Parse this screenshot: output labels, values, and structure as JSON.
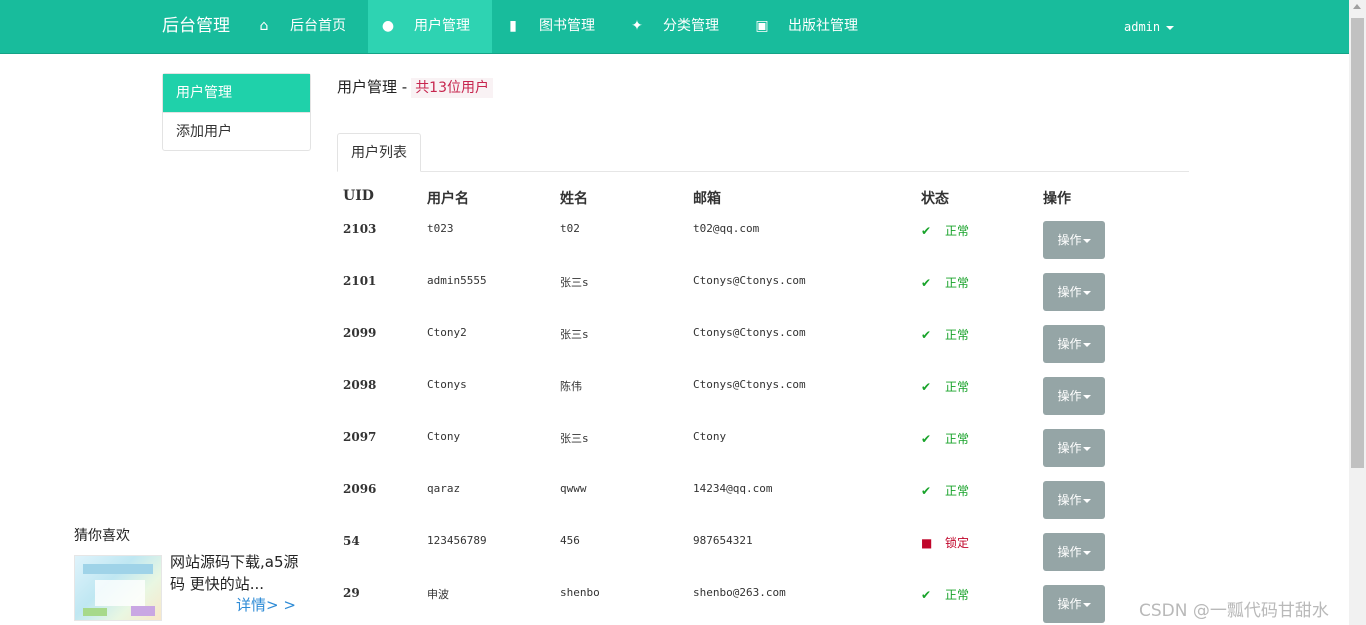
{
  "navbar": {
    "brand": "后台管理",
    "items": [
      {
        "label": "后台首页",
        "icon": "home-icon"
      },
      {
        "label": "用户管理",
        "icon": "user-icon"
      },
      {
        "label": "图书管理",
        "icon": "book-icon"
      },
      {
        "label": "分类管理",
        "icon": "pushpin-icon"
      },
      {
        "label": "出版社管理",
        "icon": "briefcase-icon"
      }
    ],
    "user": "admin",
    "bg_color": "#18bc9c"
  },
  "sidebar": {
    "items": [
      {
        "label": "用户管理",
        "active": true
      },
      {
        "label": "添加用户",
        "active": false
      }
    ]
  },
  "header": {
    "title": "用户管理 -",
    "count": "共13位用户"
  },
  "tabs": [
    {
      "label": "用户列表"
    }
  ],
  "table": {
    "columns": [
      "UID",
      "用户名",
      "姓名",
      "邮箱",
      "状态",
      "操作"
    ],
    "rows": [
      {
        "uid": "2103",
        "username": "t023",
        "name": "t02",
        "email": "t02@qq.com",
        "status": "正常",
        "status_type": "ok",
        "action": "操作"
      },
      {
        "uid": "2101",
        "username": "admin5555",
        "name": "张三s",
        "email": "Ctonys@Ctonys.com",
        "status": "正常",
        "status_type": "ok",
        "action": "操作"
      },
      {
        "uid": "2099",
        "username": "Ctony2",
        "name": "张三s",
        "email": "Ctonys@Ctonys.com",
        "status": "正常",
        "status_type": "ok",
        "action": "操作"
      },
      {
        "uid": "2098",
        "username": "Ctonys",
        "name": "陈伟",
        "email": "Ctonys@Ctonys.com",
        "status": "正常",
        "status_type": "ok",
        "action": "操作"
      },
      {
        "uid": "2097",
        "username": "Ctony",
        "name": "张三s",
        "email": "Ctony",
        "status": "正常",
        "status_type": "ok",
        "action": "操作"
      },
      {
        "uid": "2096",
        "username": "qaraz",
        "name": "qwww",
        "email": "14234@qq.com",
        "status": "正常",
        "status_type": "ok",
        "action": "操作"
      },
      {
        "uid": "54",
        "username": "123456789",
        "name": "456",
        "email": "987654321",
        "status": "锁定",
        "status_type": "locked",
        "action": "操作"
      },
      {
        "uid": "29",
        "username": "申波",
        "name": "shenbo",
        "email": "shenbo@263.com",
        "status": "正常",
        "status_type": "ok",
        "action": "操作"
      }
    ]
  },
  "recommend": {
    "title": "猜你喜欢",
    "text": "网站源码下载,a5源码 更快的站...",
    "more": "详情> >"
  },
  "watermark": "CSDN @一瓢代码甘甜水"
}
